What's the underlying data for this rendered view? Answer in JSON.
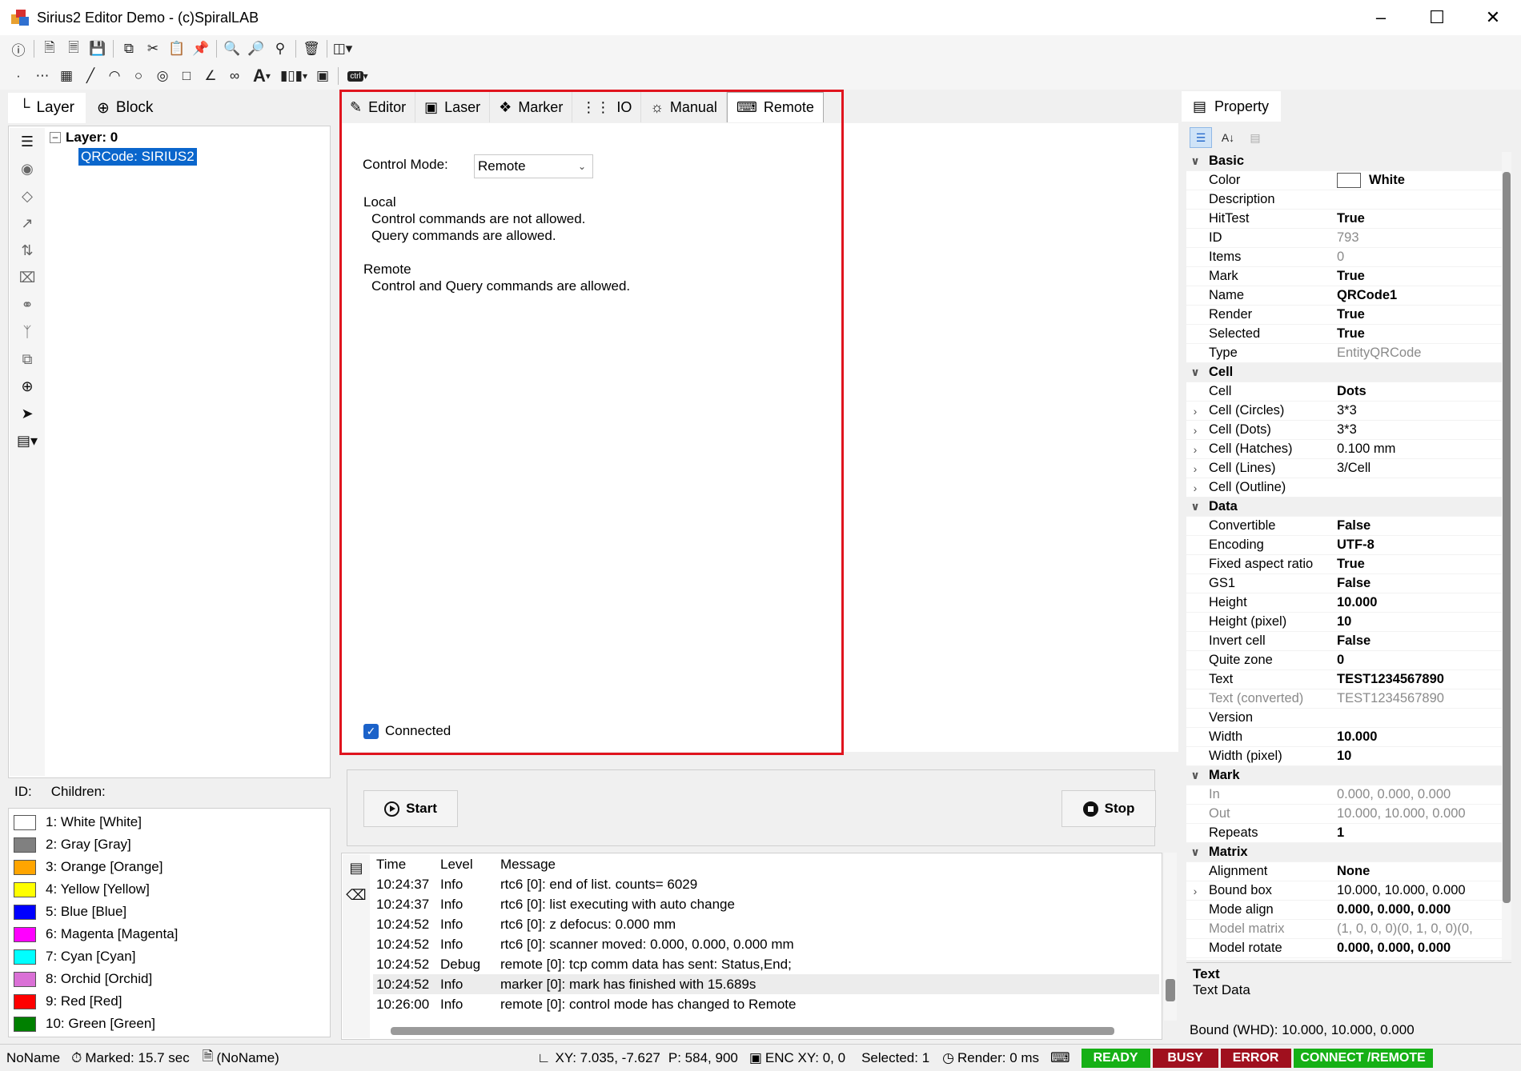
{
  "window": {
    "title": "Sirius2 Editor Demo - (c)SpiralLAB"
  },
  "left": {
    "tabs": [
      {
        "label": "Layer"
      },
      {
        "label": "Block"
      }
    ],
    "tree": {
      "layer": "Layer: 0",
      "child": "QRCode: SIRIUS2"
    },
    "id_label": "ID:",
    "children_label": "Children:",
    "pens": [
      {
        "label": "1: White [White]",
        "color": "#ffffff"
      },
      {
        "label": "2: Gray [Gray]",
        "color": "#808080"
      },
      {
        "label": "3: Orange [Orange]",
        "color": "#ffa500"
      },
      {
        "label": "4: Yellow [Yellow]",
        "color": "#ffff00"
      },
      {
        "label": "5: Blue [Blue]",
        "color": "#0000ff"
      },
      {
        "label": "6: Magenta [Magenta]",
        "color": "#ff00ff"
      },
      {
        "label": "7: Cyan [Cyan]",
        "color": "#00ffff"
      },
      {
        "label": "8: Orchid [Orchid]",
        "color": "#da70d6"
      },
      {
        "label": "9: Red [Red]",
        "color": "#ff0000"
      },
      {
        "label": "10: Green [Green]",
        "color": "#008000"
      }
    ]
  },
  "center": {
    "tabs": [
      {
        "label": "Editor"
      },
      {
        "label": "Laser"
      },
      {
        "label": "Marker"
      },
      {
        "label": "IO"
      },
      {
        "label": "Manual"
      },
      {
        "label": "Remote"
      }
    ],
    "control_mode_label": "Control Mode:",
    "control_mode_value": "Remote",
    "local_title": "Local",
    "local_line1": "Control commands are not allowed.",
    "local_line2": "Query commands are allowed.",
    "remote_title": "Remote",
    "remote_line1": "Control and Query commands are allowed.",
    "connected_label": "Connected",
    "start_label": "Start",
    "stop_label": "Stop"
  },
  "log": {
    "headers": {
      "time": "Time",
      "level": "Level",
      "message": "Message"
    },
    "rows": [
      {
        "time": "10:24:37",
        "level": "Info",
        "message": "rtc6 [0]: end of list. counts= 6029"
      },
      {
        "time": "10:24:37",
        "level": "Info",
        "message": "rtc6 [0]: list executing with auto change"
      },
      {
        "time": "10:24:52",
        "level": "Info",
        "message": "rtc6 [0]: z defocus: 0.000 mm"
      },
      {
        "time": "10:24:52",
        "level": "Info",
        "message": "rtc6 [0]: scanner moved: 0.000, 0.000, 0.000 mm"
      },
      {
        "time": "10:24:52",
        "level": "Debug",
        "message": "remote [0]: tcp comm data has sent: Status,End;"
      },
      {
        "time": "10:24:52",
        "level": "Info",
        "message": "marker [0]: mark has finished with 15.689s"
      },
      {
        "time": "10:26:00",
        "level": "Info",
        "message": "remote [0]: control mode has changed to Remote"
      }
    ]
  },
  "property": {
    "tab_label": "Property",
    "rows": [
      {
        "kind": "cat",
        "name": "Basic"
      },
      {
        "name": "Color",
        "value": "White",
        "swatch": "#ffffff",
        "bold": true
      },
      {
        "name": "Description",
        "value": ""
      },
      {
        "name": "HitTest",
        "value": "True",
        "bold": true
      },
      {
        "name": "ID",
        "value": "793",
        "gray": true
      },
      {
        "name": "Items",
        "value": "0",
        "gray": true
      },
      {
        "name": "Mark",
        "value": "True",
        "bold": true
      },
      {
        "name": "Name",
        "value": "QRCode1",
        "bold": true
      },
      {
        "name": "Render",
        "value": "True",
        "bold": true
      },
      {
        "name": "Selected",
        "value": "True",
        "bold": true
      },
      {
        "name": "Type",
        "value": "EntityQRCode",
        "gray": true
      },
      {
        "kind": "cat",
        "name": "Cell"
      },
      {
        "name": "Cell",
        "value": "Dots",
        "bold": true
      },
      {
        "name": "Cell (Circles)",
        "value": "3*3",
        "expand": true
      },
      {
        "name": "Cell (Dots)",
        "value": "3*3",
        "expand": true
      },
      {
        "name": "Cell (Hatches)",
        "value": "0.100 mm",
        "expand": true
      },
      {
        "name": "Cell (Lines)",
        "value": "3/Cell",
        "expand": true
      },
      {
        "name": "Cell (Outline)",
        "value": "",
        "expand": true
      },
      {
        "kind": "cat",
        "name": "Data"
      },
      {
        "name": "Convertible",
        "value": "False",
        "bold": true
      },
      {
        "name": "Encoding",
        "value": "UTF-8",
        "bold": true
      },
      {
        "name": "Fixed aspect ratio",
        "value": "True",
        "bold": true
      },
      {
        "name": "GS1",
        "value": "False",
        "bold": true
      },
      {
        "name": "Height",
        "value": "10.000",
        "bold": true
      },
      {
        "name": "Height (pixel)",
        "value": "10",
        "bold": true
      },
      {
        "name": "Invert cell",
        "value": "False",
        "bold": true
      },
      {
        "name": "Quite zone",
        "value": "0",
        "bold": true
      },
      {
        "name": "Text",
        "value": "TEST1234567890",
        "bold": true
      },
      {
        "name": "Text (converted)",
        "value": "TEST1234567890",
        "gray": true,
        "grayname": true
      },
      {
        "name": "Version",
        "value": ""
      },
      {
        "name": "Width",
        "value": "10.000",
        "bold": true
      },
      {
        "name": "Width (pixel)",
        "value": "10",
        "bold": true
      },
      {
        "kind": "cat",
        "name": "Mark"
      },
      {
        "name": "In",
        "value": "0.000, 0.000, 0.000",
        "gray": true,
        "grayname": true
      },
      {
        "name": "Out",
        "value": "10.000, 10.000, 0.000",
        "gray": true,
        "grayname": true
      },
      {
        "name": "Repeats",
        "value": "1",
        "bold": true
      },
      {
        "kind": "cat",
        "name": "Matrix"
      },
      {
        "name": "Alignment",
        "value": "None",
        "bold": true
      },
      {
        "name": "Bound box",
        "value": "10.000, 10.000, 0.000",
        "expand": true
      },
      {
        "name": "Mode align",
        "value": "0.000, 0.000, 0.000",
        "bold": true
      },
      {
        "name": "Model matrix",
        "value": "(1, 0, 0, 0)(0, 1, 0, 0)(0,",
        "gray": true,
        "grayname": true
      },
      {
        "name": "Model rotate",
        "value": "0.000, 0.000, 0.000",
        "bold": true
      }
    ],
    "desc_title": "Text",
    "desc_body": "Text Data",
    "bound": "Bound (WHD): 10.000, 10.000, 0.000"
  },
  "status": {
    "document": "NoName",
    "marked": "Marked: 15.7 sec",
    "file": "(NoName)",
    "xy": "XY: 7.035, -7.627",
    "p": "P: 584, 900",
    "enc": "ENC XY: 0, 0",
    "selected": "Selected: 1",
    "render": "Render: 0 ms",
    "badges": [
      {
        "label": "READY",
        "color": "#16b016"
      },
      {
        "label": "BUSY",
        "color": "#a0101e"
      },
      {
        "label": "ERROR",
        "color": "#a0101e"
      },
      {
        "label": "CONNECT /REMOTE",
        "color": "#16b016"
      }
    ]
  }
}
